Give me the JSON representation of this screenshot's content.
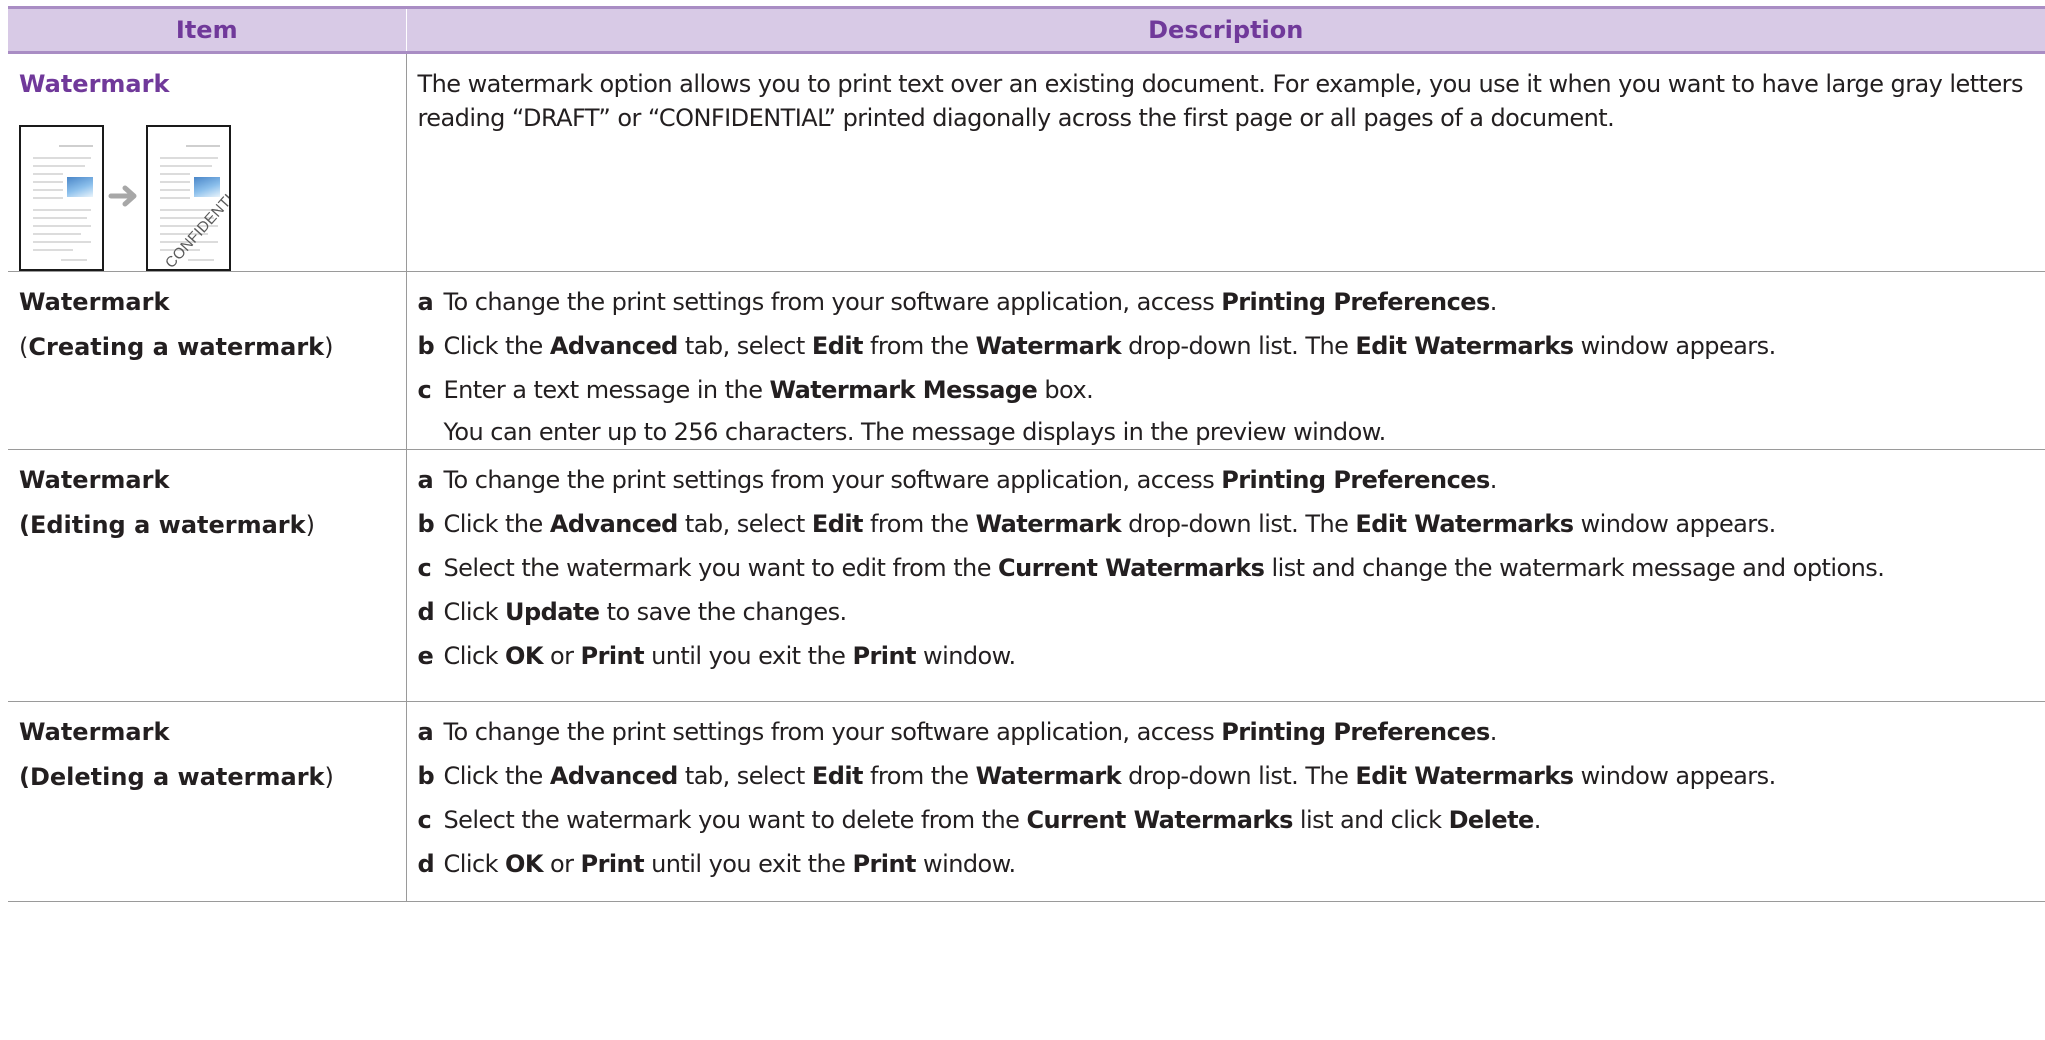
{
  "table": {
    "headers": {
      "item": "Item",
      "description": "Description"
    },
    "intro_row": {
      "item_title": "Watermark",
      "description": "The watermark option allows you to print text over an existing document. For example, you use it when you want to have large gray letters reading “DRAFT” or “CONFIDENTIAL” printed diagonally across the first page or all pages of a document.",
      "illustration_watermark_text": "CONFIDENTIAL"
    },
    "creating": {
      "item_title": "Watermark",
      "item_sub_open": "(",
      "item_sub_bold": "Creating a watermark",
      "item_sub_close": ")",
      "steps": [
        {
          "letter": "a",
          "parts": [
            "To change the print settings from your software application, access ",
            "Printing Preferences",
            "."
          ]
        },
        {
          "letter": "b",
          "parts": [
            "Click the ",
            "Advanced",
            " tab, select ",
            "Edit",
            " from the ",
            "Watermark",
            " drop-down list. The ",
            "Edit Watermarks",
            " window appears."
          ]
        },
        {
          "letter": "c",
          "parts": [
            "Enter a text message in the ",
            "Watermark Message",
            " box."
          ]
        }
      ],
      "note": "You can enter up to 256 characters. The message displays in the preview window."
    },
    "editing": {
      "item_title": "Watermark",
      "item_sub_bold": "(Editing a watermark",
      "item_sub_close": ")",
      "steps": [
        {
          "letter": "a",
          "parts": [
            "To change the print settings from your software application, access ",
            "Printing Preferences",
            "."
          ]
        },
        {
          "letter": "b",
          "parts": [
            "Click the ",
            "Advanced",
            " tab, select ",
            "Edit",
            " from the ",
            "Watermark",
            " drop-down list. The ",
            "Edit Watermarks",
            " window appears."
          ]
        },
        {
          "letter": "c",
          "parts": [
            "Select the watermark you want to edit from the ",
            "Current Watermarks",
            " list and change the watermark message and options."
          ]
        },
        {
          "letter": "d",
          "parts": [
            "Click ",
            "Update",
            " to save the changes."
          ]
        },
        {
          "letter": "e",
          "parts": [
            "Click ",
            "OK",
            " or ",
            "Print",
            " until you exit the ",
            "Print",
            " window."
          ]
        }
      ]
    },
    "deleting": {
      "item_title": "Watermark",
      "item_sub_bold": "(Deleting a watermark",
      "item_sub_close": ")",
      "steps": [
        {
          "letter": "a",
          "parts": [
            "To change the print settings from your software application, access ",
            "Printing Preferences",
            "."
          ]
        },
        {
          "letter": "b",
          "parts": [
            "Click the ",
            "Advanced",
            " tab, select ",
            "Edit",
            " from the ",
            "Watermark",
            " drop-down list. The ",
            "Edit Watermarks",
            " window appears."
          ]
        },
        {
          "letter": "c",
          "parts": [
            "Select the watermark you want to delete from the ",
            "Current Watermarks",
            " list and click ",
            "Delete",
            "."
          ]
        },
        {
          "letter": "d",
          "parts": [
            "Click ",
            "OK",
            " or ",
            "Print",
            " until you exit the ",
            "Print",
            " window."
          ]
        }
      ]
    }
  },
  "colors": {
    "header_bg": "#d8cae6",
    "header_text": "#70399a",
    "accent_border": "#a98dc4",
    "body_text": "#231f20",
    "rule": "#9a9a9a"
  }
}
